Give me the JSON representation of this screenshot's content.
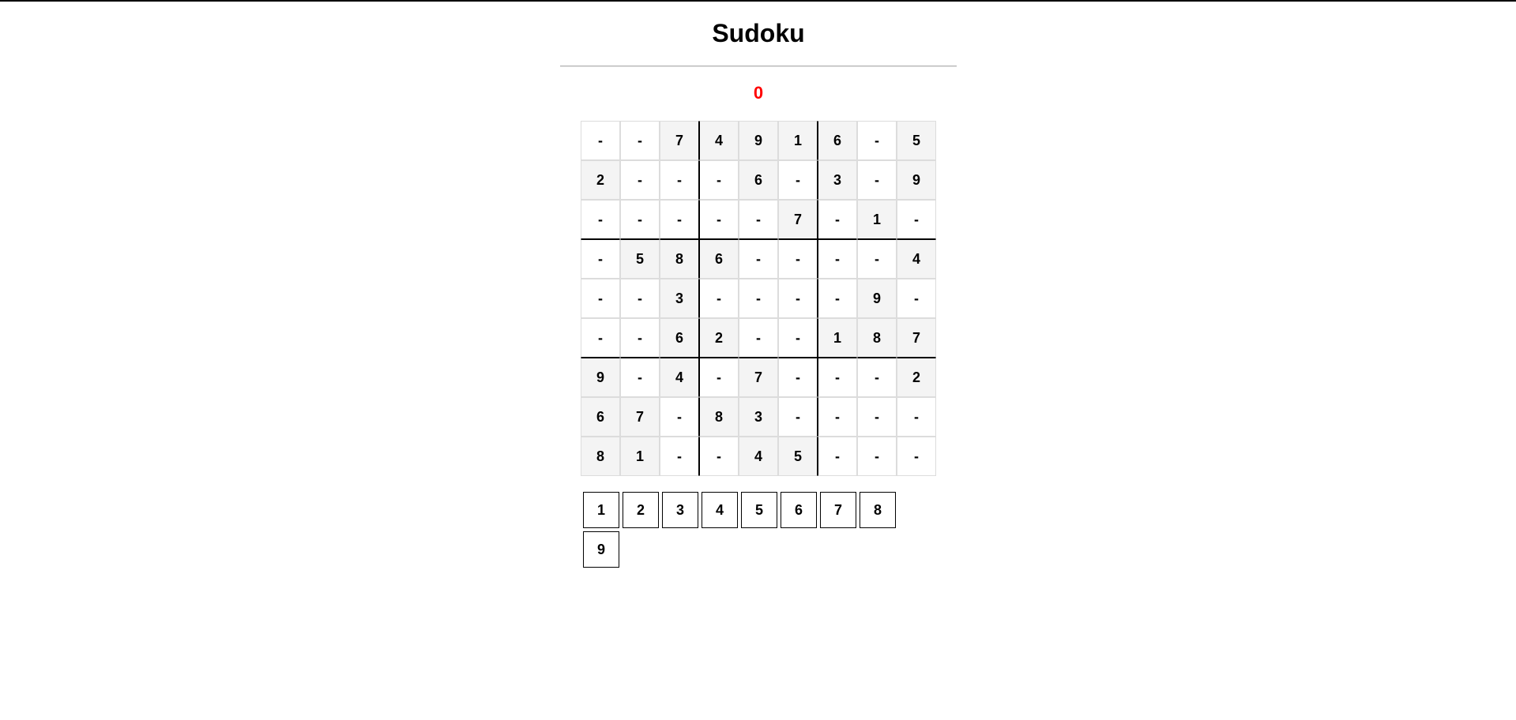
{
  "title": "Sudoku",
  "score": "0",
  "score_color": "#ff0000",
  "board": [
    [
      {
        "v": "-",
        "g": false
      },
      {
        "v": "-",
        "g": false
      },
      {
        "v": "7",
        "g": true
      },
      {
        "v": "4",
        "g": true
      },
      {
        "v": "9",
        "g": true
      },
      {
        "v": "1",
        "g": true
      },
      {
        "v": "6",
        "g": true
      },
      {
        "v": "-",
        "g": false
      },
      {
        "v": "5",
        "g": true
      }
    ],
    [
      {
        "v": "2",
        "g": true
      },
      {
        "v": "-",
        "g": false
      },
      {
        "v": "-",
        "g": false
      },
      {
        "v": "-",
        "g": false
      },
      {
        "v": "6",
        "g": true
      },
      {
        "v": "-",
        "g": false
      },
      {
        "v": "3",
        "g": true
      },
      {
        "v": "-",
        "g": false
      },
      {
        "v": "9",
        "g": true
      }
    ],
    [
      {
        "v": "-",
        "g": false
      },
      {
        "v": "-",
        "g": false
      },
      {
        "v": "-",
        "g": false
      },
      {
        "v": "-",
        "g": false
      },
      {
        "v": "-",
        "g": false
      },
      {
        "v": "7",
        "g": true
      },
      {
        "v": "-",
        "g": false
      },
      {
        "v": "1",
        "g": true
      },
      {
        "v": "-",
        "g": false
      }
    ],
    [
      {
        "v": "-",
        "g": false
      },
      {
        "v": "5",
        "g": true
      },
      {
        "v": "8",
        "g": true
      },
      {
        "v": "6",
        "g": true
      },
      {
        "v": "-",
        "g": false
      },
      {
        "v": "-",
        "g": false
      },
      {
        "v": "-",
        "g": false
      },
      {
        "v": "-",
        "g": false
      },
      {
        "v": "4",
        "g": true
      }
    ],
    [
      {
        "v": "-",
        "g": false
      },
      {
        "v": "-",
        "g": false
      },
      {
        "v": "3",
        "g": true
      },
      {
        "v": "-",
        "g": false
      },
      {
        "v": "-",
        "g": false
      },
      {
        "v": "-",
        "g": false
      },
      {
        "v": "-",
        "g": false
      },
      {
        "v": "9",
        "g": true
      },
      {
        "v": "-",
        "g": false
      }
    ],
    [
      {
        "v": "-",
        "g": false
      },
      {
        "v": "-",
        "g": false
      },
      {
        "v": "6",
        "g": true
      },
      {
        "v": "2",
        "g": true
      },
      {
        "v": "-",
        "g": false
      },
      {
        "v": "-",
        "g": false
      },
      {
        "v": "1",
        "g": true
      },
      {
        "v": "8",
        "g": true
      },
      {
        "v": "7",
        "g": true
      }
    ],
    [
      {
        "v": "9",
        "g": true
      },
      {
        "v": "-",
        "g": false
      },
      {
        "v": "4",
        "g": true
      },
      {
        "v": "-",
        "g": false
      },
      {
        "v": "7",
        "g": true
      },
      {
        "v": "-",
        "g": false
      },
      {
        "v": "-",
        "g": false
      },
      {
        "v": "-",
        "g": false
      },
      {
        "v": "2",
        "g": true
      }
    ],
    [
      {
        "v": "6",
        "g": true
      },
      {
        "v": "7",
        "g": true
      },
      {
        "v": "-",
        "g": false
      },
      {
        "v": "8",
        "g": true
      },
      {
        "v": "3",
        "g": true
      },
      {
        "v": "-",
        "g": false
      },
      {
        "v": "-",
        "g": false
      },
      {
        "v": "-",
        "g": false
      },
      {
        "v": "-",
        "g": false
      }
    ],
    [
      {
        "v": "8",
        "g": true
      },
      {
        "v": "1",
        "g": true
      },
      {
        "v": "-",
        "g": false
      },
      {
        "v": "-",
        "g": false
      },
      {
        "v": "4",
        "g": true
      },
      {
        "v": "5",
        "g": true
      },
      {
        "v": "-",
        "g": false
      },
      {
        "v": "-",
        "g": false
      },
      {
        "v": "-",
        "g": false
      }
    ]
  ],
  "numpad": [
    "1",
    "2",
    "3",
    "4",
    "5",
    "6",
    "7",
    "8",
    "9"
  ]
}
